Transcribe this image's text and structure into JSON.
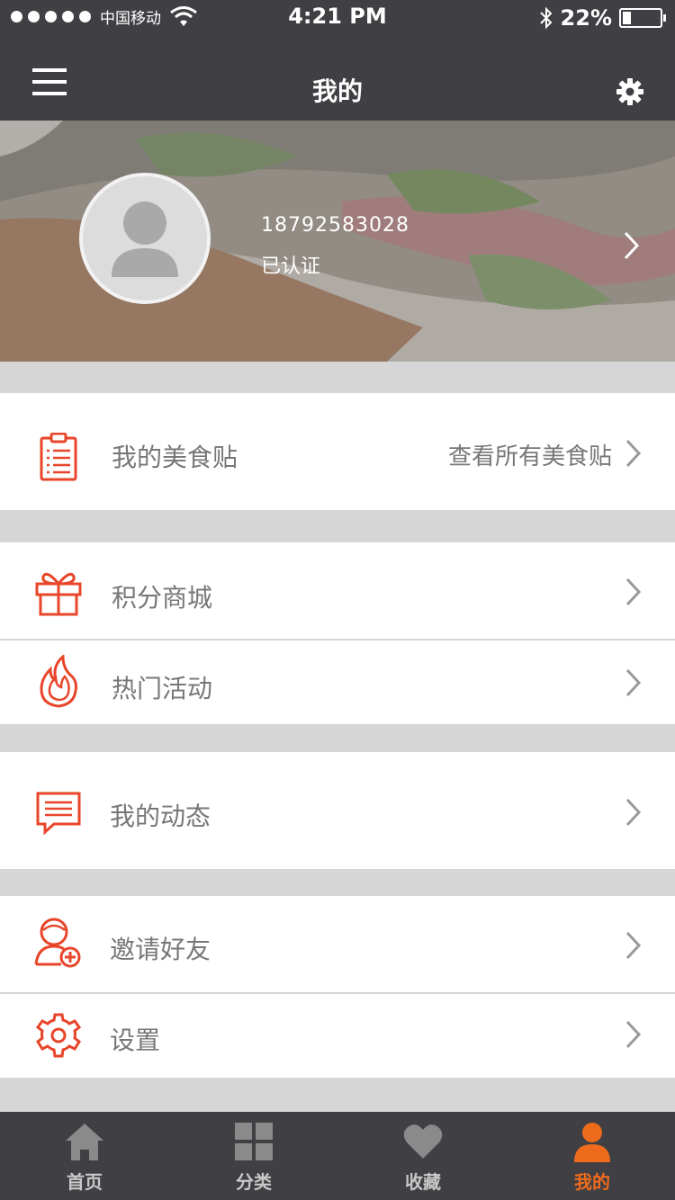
{
  "status_bar": {
    "carrier": "中国移动",
    "time": "4:21 PM",
    "battery": "22%",
    "battery_level": 0.22
  },
  "nav": {
    "title": "我的",
    "menu_icon": "hamburger-menu-icon",
    "settings_icon": "gear-icon"
  },
  "profile": {
    "phone": "18792583028",
    "status": "已认证"
  },
  "menu": {
    "food_posts": {
      "label": "我的美食贴",
      "extra": "查看所有美食贴",
      "icon": "clipboard-icon"
    },
    "points_mall": {
      "label": "积分商城",
      "icon": "gift-icon"
    },
    "hot_events": {
      "label": "热门活动",
      "icon": "flame-icon"
    },
    "my_updates": {
      "label": "我的动态",
      "icon": "message-icon"
    },
    "invite": {
      "label": "邀请好友",
      "icon": "add-friend-icon"
    },
    "settings": {
      "label": "设置",
      "icon": "gear-icon"
    }
  },
  "tabbar": {
    "tabs": [
      {
        "label": "首页",
        "icon": "home-icon"
      },
      {
        "label": "分类",
        "icon": "grid-icon"
      },
      {
        "label": "收藏",
        "icon": "heart-icon"
      },
      {
        "label": "我的",
        "icon": "person-icon"
      }
    ],
    "active_index": 3
  },
  "colors": {
    "accent": "#ef6b1c",
    "icon_red": "#e8452a",
    "bar_bg": "#403f43",
    "separator": "#d6d6d6"
  }
}
